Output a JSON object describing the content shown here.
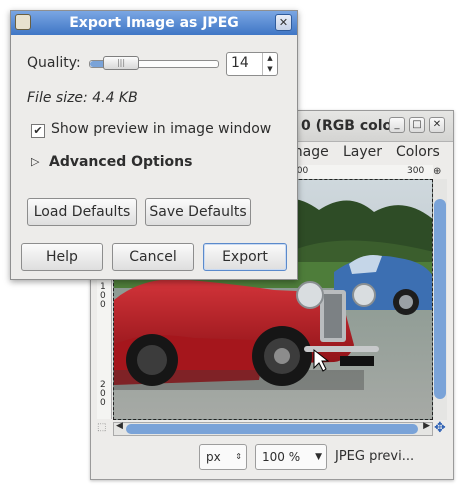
{
  "image_window": {
    "title": "0 (RGB colo",
    "menu": [
      "mage",
      "Layer",
      "Colors"
    ],
    "ruler_top": [
      "300",
      "300"
    ],
    "ruler_left": [
      "1",
      "0",
      "0",
      "2",
      "0",
      "0"
    ],
    "statusbar": {
      "unit": "px",
      "zoom": "100 %",
      "status": "JPEG previ..."
    },
    "buttons": {
      "minimize": "_",
      "maximize": "□",
      "close": "✕"
    }
  },
  "dialog": {
    "title": "Export Image as JPEG",
    "quality_label": "Quality:",
    "quality_value": "14",
    "quality_fraction": 0.14,
    "file_size": "File size: 4.4 KB",
    "show_preview_label": "Show preview in image window",
    "show_preview_checked": true,
    "advanced_options_label": "Advanced Options",
    "load_defaults": "Load Defaults",
    "save_defaults": "Save Defaults",
    "help": "Help",
    "cancel": "Cancel",
    "export": "Export",
    "close_icon": "✕"
  },
  "colors": {
    "titlebar_active": "#3f76c5",
    "accent": "#7aa3d8",
    "car_red": "#b81d24"
  }
}
